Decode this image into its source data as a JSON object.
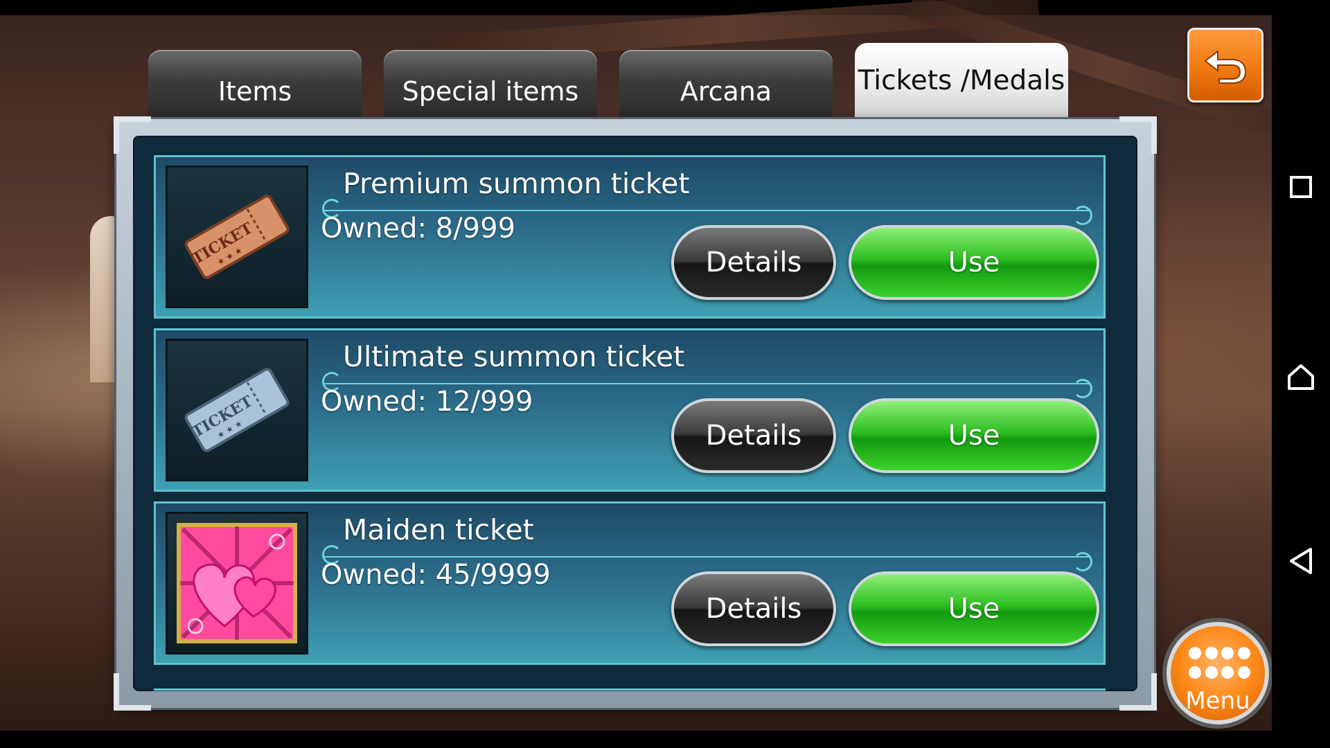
{
  "tabs": [
    {
      "label": "Items",
      "active": false
    },
    {
      "label": "Special items",
      "active": false
    },
    {
      "label": "Arcana",
      "active": false
    },
    {
      "label": "Tickets /Medals",
      "active": true
    }
  ],
  "items": [
    {
      "name": "Premium summon ticket",
      "owned": "Owned: 8/999",
      "details_label": "Details",
      "use_label": "Use",
      "icon": "bronze-ticket-icon",
      "icon_text": "TICKET"
    },
    {
      "name": "Ultimate summon ticket",
      "owned": "Owned: 12/999",
      "details_label": "Details",
      "use_label": "Use",
      "icon": "silver-ticket-icon",
      "icon_text": "TICKET"
    },
    {
      "name": "Maiden ticket",
      "owned": "Owned: 45/9999",
      "details_label": "Details",
      "use_label": "Use",
      "icon": "heart-ticket-icon"
    }
  ],
  "menu": {
    "label": "Menu"
  },
  "colors": {
    "use_green": "#1fae18",
    "details_dark": "#2a2a2a",
    "back_orange": "#f07a12",
    "row_teal": "#2b6b88"
  }
}
